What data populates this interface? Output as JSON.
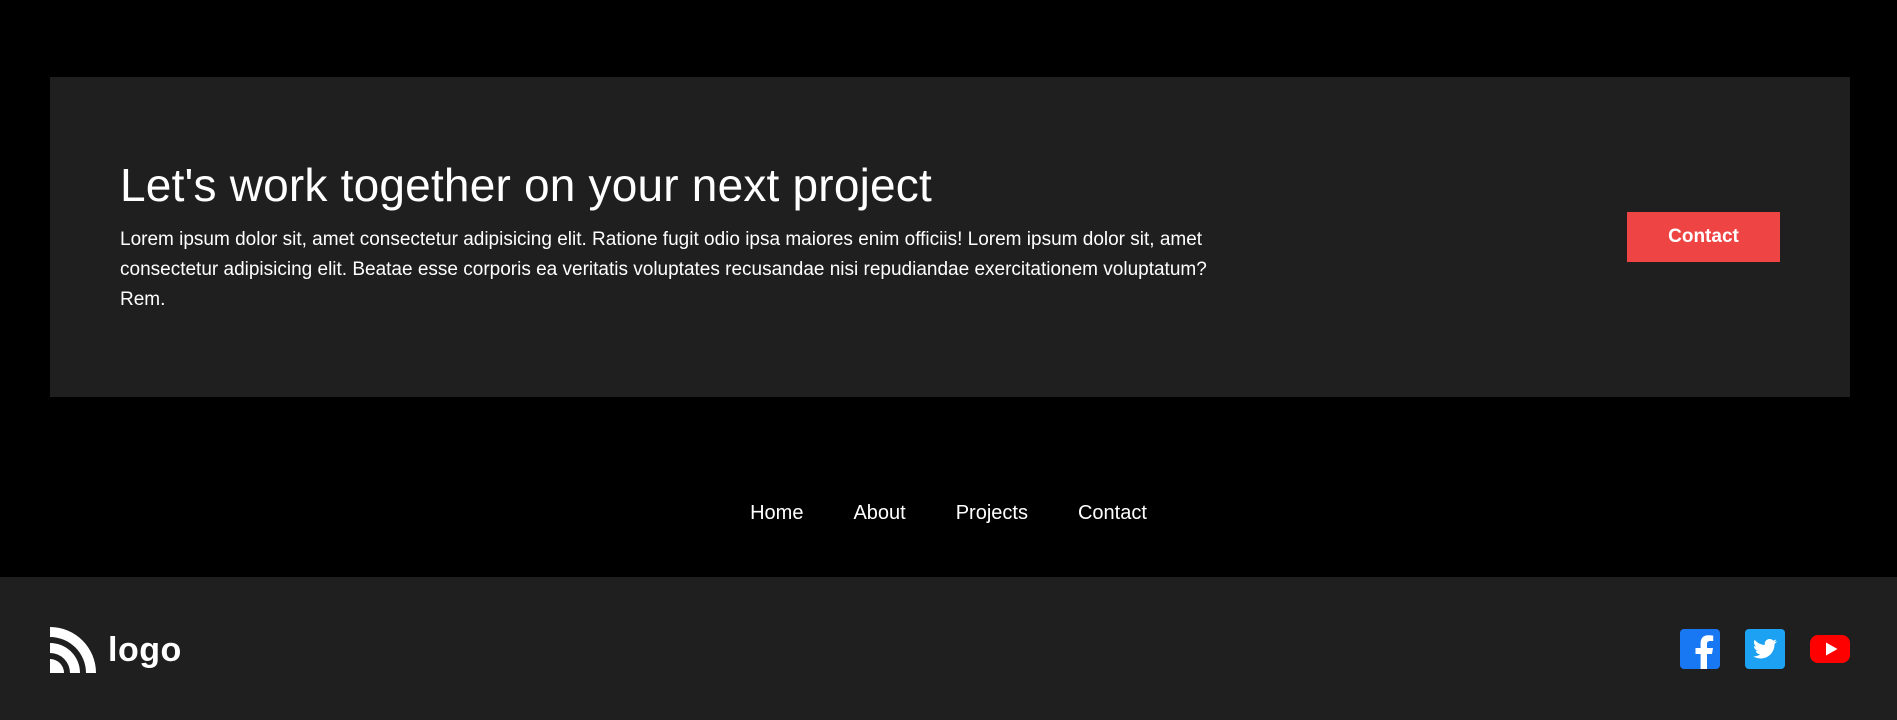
{
  "cta": {
    "title": "Let's work together on your next project",
    "body": "Lorem ipsum dolor sit, amet consectetur adipisicing elit. Ratione fugit odio ipsa maiores enim officiis! Lorem ipsum dolor sit, amet consectetur adipisicing elit. Beatae esse corporis ea veritatis voluptates recusandae nisi repudiandae exercitationem voluptatum? Rem.",
    "button_label": "Contact",
    "button_color": "#ef4444"
  },
  "nav": {
    "items": [
      {
        "label": "Home"
      },
      {
        "label": "About"
      },
      {
        "label": "Projects"
      },
      {
        "label": "Contact"
      }
    ]
  },
  "footer": {
    "logo_text": "logo",
    "logo_icon": "rss-arcs-icon",
    "socials": [
      {
        "name": "facebook",
        "icon": "facebook-icon",
        "color": "#1877f2"
      },
      {
        "name": "twitter",
        "icon": "twitter-icon",
        "color": "#1da1f2"
      },
      {
        "name": "youtube",
        "icon": "youtube-icon",
        "color": "#ff0000"
      }
    ]
  },
  "colors": {
    "page_background": "#000000",
    "card_background": "#1f1f1f",
    "text": "#ffffff"
  }
}
